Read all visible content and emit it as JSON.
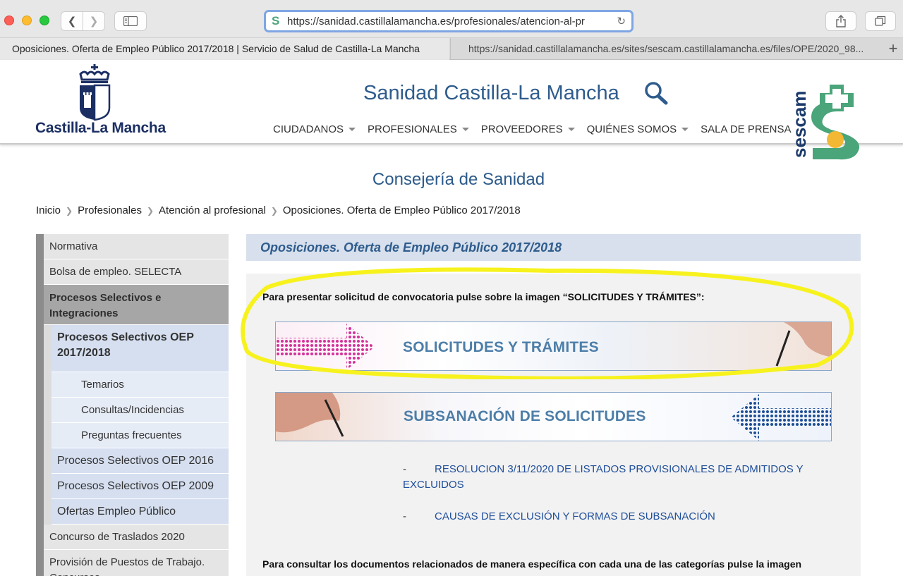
{
  "browser": {
    "url": "https://sanidad.castillalamancha.es/profesionales/atencion-al-pr",
    "tabs": [
      {
        "title": "Oposiciones. Oferta de Empleo Público 2017/2018 | Servicio de Salud de Castilla-La Mancha",
        "active": true
      },
      {
        "title": "https://sanidad.castillalamancha.es/sites/sescam.castillalamancha.es/files/OPE/2020_98...",
        "active": false
      }
    ],
    "new_tab": "+"
  },
  "header": {
    "logo_text": "Castilla-La Mancha",
    "site_title": "Sanidad Castilla-La Mancha",
    "nav": [
      "CIUDADANOS",
      "PROFESIONALES",
      "PROVEEDORES",
      "QUIÉNES SOMOS",
      "SALA DE PRENSA"
    ],
    "sescam_text": "sescam"
  },
  "page": {
    "heading": "Consejería de Sanidad",
    "breadcrumb": [
      "Inicio",
      "Profesionales",
      "Atención al profesional",
      "Oposiciones. Oferta de Empleo Público 2017/2018"
    ]
  },
  "sidebar": {
    "items": [
      "Normativa",
      "Bolsa de empleo. SELECTA",
      "Procesos Selectivos e Integraciones",
      "Procesos Selectivos OEP 2017/2018",
      "Temarios",
      "Consultas/Incidencias",
      "Preguntas frecuentes",
      "Procesos Selectivos OEP 2016",
      "Procesos Selectivos OEP 2009",
      "Ofertas Empleo Público",
      "Concurso de Traslados 2020",
      "Provisión de Puestos de Trabajo. Concursos"
    ]
  },
  "content": {
    "title": "Oposiciones. Oferta de Empleo Público 2017/2018",
    "instruction": "Para presentar solicitud de convocatoria pulse sobre la imagen “SOLICITUDES Y TRÁMITES”:",
    "banner1": "SOLICITUDES Y TRÁMITES",
    "banner2": "SUBSANACIÓN DE SOLICITUDES",
    "links": [
      {
        "dash": "-",
        "text": "RESOLUCION 3/11/2020 DE LISTADOS PROVISIONALES DE ADMITIDOS Y EXCLUIDOS"
      },
      {
        "dash": "-",
        "text": "CAUSAS DE EXCLUSIÓN Y FORMAS DE SUBSANACIÓN"
      }
    ],
    "instruction2": "Para consultar los documentos relacionados de manera específica con cada una de las categorías pulse la imagen"
  },
  "colors": {
    "brand_blue": "#2f5c8d",
    "highlight": "#f7f21d",
    "sescam_green": "#4aa57a",
    "sescam_yellow": "#f2b733",
    "sescam_navy": "#1b3a6b"
  }
}
